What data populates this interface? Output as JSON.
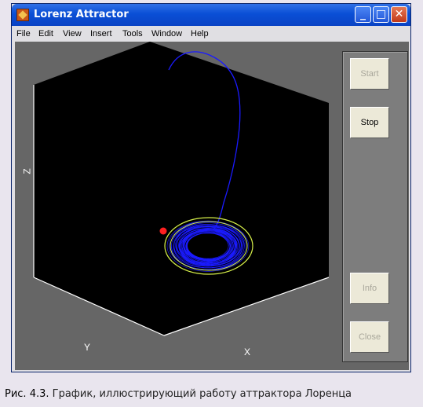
{
  "window": {
    "title": "Lorenz Attractor"
  },
  "menu": {
    "items": [
      "File",
      "Edit",
      "View",
      "Insert",
      "Tools",
      "Window",
      "Help"
    ]
  },
  "axes": {
    "x_label": "X",
    "y_label": "Y",
    "z_label": "Z"
  },
  "controls": {
    "start_label": "Start",
    "stop_label": "Stop",
    "info_label": "Info",
    "close_label": "Close",
    "start_enabled": false,
    "stop_enabled": true,
    "info_enabled": false,
    "close_enabled": false
  },
  "colors": {
    "trajectory": "#1a1aff",
    "orbit": "#d7f04a",
    "marker": "#ff2020",
    "plot_background": "#000000"
  },
  "caption": {
    "label": "Рис. 4.3.",
    "text": "График, иллюстрирующий работу аттрактора Лоренца"
  }
}
